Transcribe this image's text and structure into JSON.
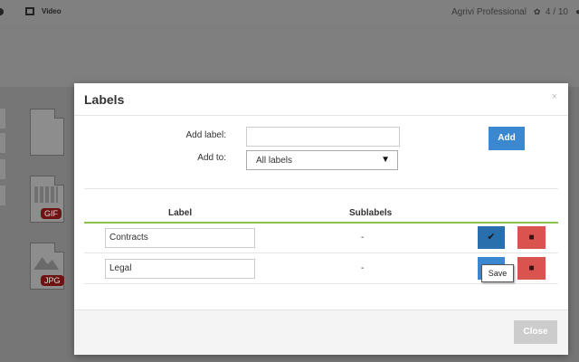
{
  "topbar": {
    "nav_video": "Video",
    "plan_name": "Agrivi Professional",
    "plan_count": "4 / 10"
  },
  "files": [
    {
      "type": "blank",
      "tag": ""
    },
    {
      "type": "gif",
      "tag": "GIF"
    },
    {
      "type": "jpg",
      "tag": "JPG"
    }
  ],
  "modal": {
    "title": "Labels",
    "close_symbol": "×",
    "add_label_caption": "Add label:",
    "add_label_value": "",
    "add_to_caption": "Add to:",
    "add_to_selected": "All labels",
    "add_button": "Add",
    "table": {
      "headers": [
        "Label",
        "Sublabels"
      ],
      "rows": [
        {
          "label": "Contracts",
          "sublabels": "-"
        },
        {
          "label": "Legal",
          "sublabels": "-"
        }
      ]
    },
    "tooltip": "Save",
    "footer_close": "Close"
  },
  "colors": {
    "primary": "#3b87d0",
    "primary_dark": "#2a6fad",
    "danger": "#d9534f",
    "accent_green": "#8bc34a",
    "disabled": "#cccccc"
  },
  "icons": {
    "save": "check-icon",
    "delete": "trash-icon",
    "plan": "leaf-icon",
    "user": "user-icon",
    "video": "film-icon"
  }
}
